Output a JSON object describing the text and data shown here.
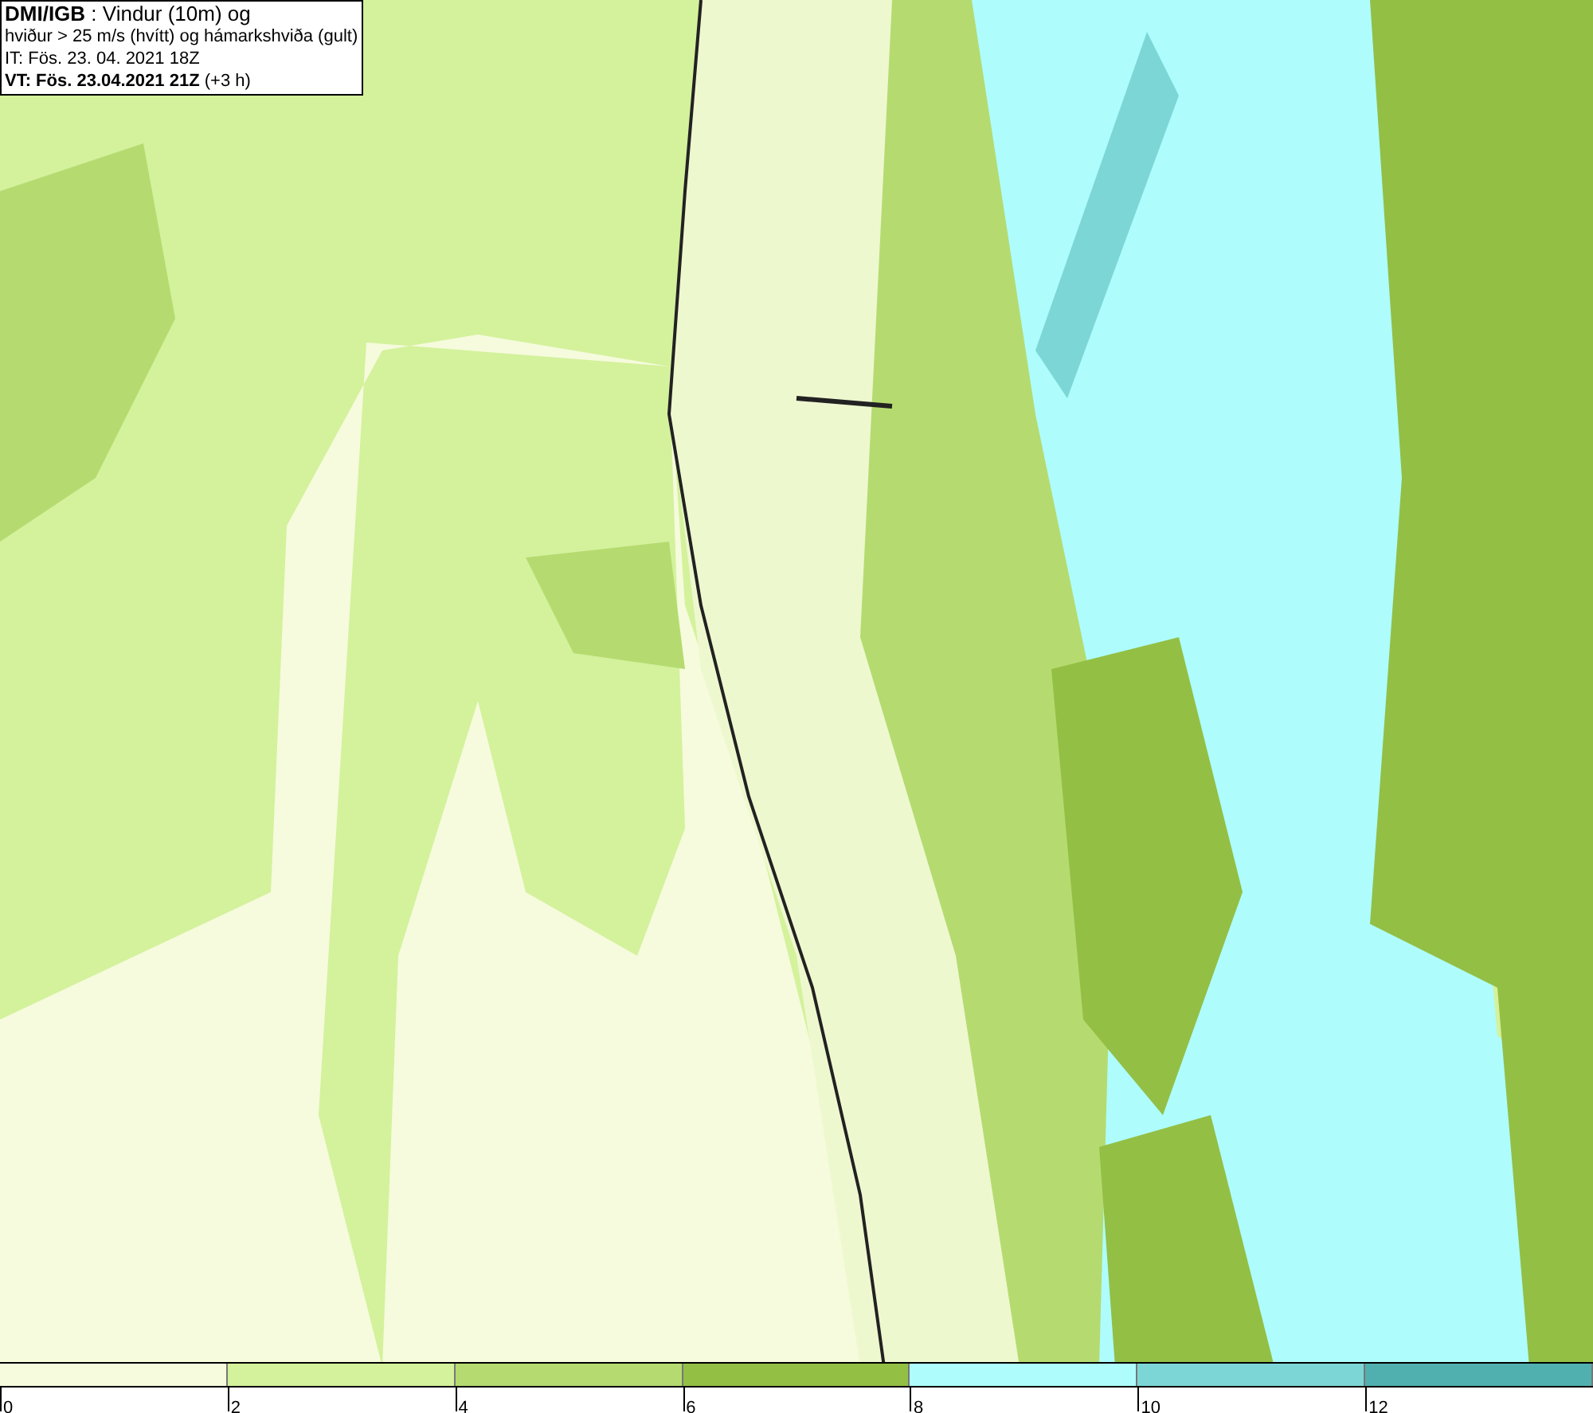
{
  "info_box": {
    "lines": [
      "**DMI/IGB** : Vindur (10m) og",
      "hviður > 25 m/s (hvítt) og hámarkshviða (gult)",
      "IT: Fös. 23. 04. 2021 18Z",
      "**VT: Fös. 23.04.2021 21Z** (+3 h)"
    ]
  },
  "legend": [
    {
      "label": "0",
      "color": "#f5fbdc"
    },
    {
      "label": "2",
      "color": "#d4f19c"
    },
    {
      "label": "4",
      "color": "#b5db70"
    },
    {
      "label": "6",
      "color": "#93bf45"
    },
    {
      "label": "8",
      "color": "#aefcfc"
    },
    {
      "label": "10",
      "color": "#7dd6d6"
    },
    {
      "label": "12",
      "color": "#50b0b0"
    }
  ]
}
